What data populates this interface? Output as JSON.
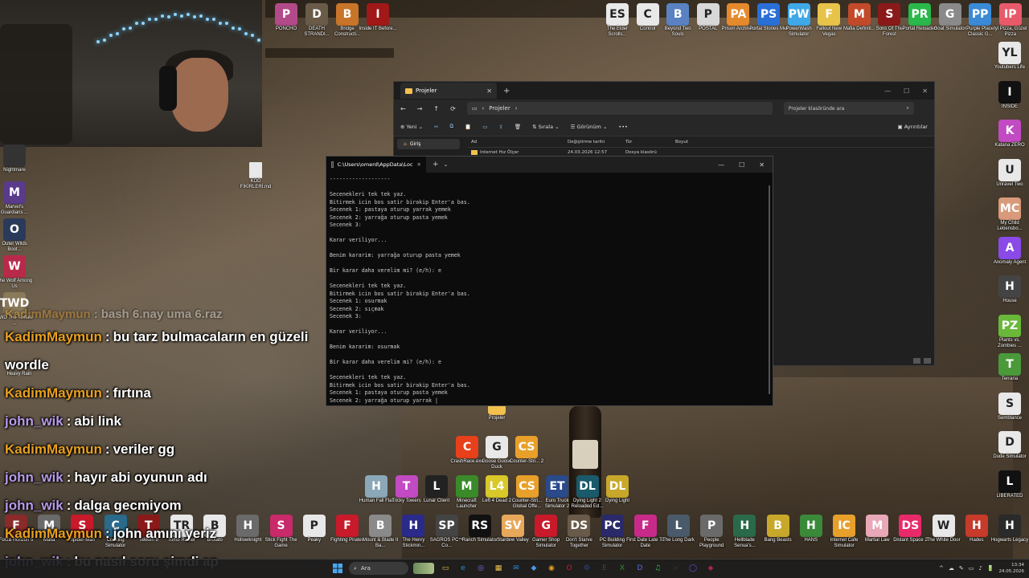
{
  "webcam": {},
  "desktop_icons_top": [
    {
      "label": "PONCHO",
      "color": "#b24a8a",
      "glyph": "P"
    },
    {
      "label": "DEATH STRANDI...",
      "color": "#6a5b49",
      "glyph": "D"
    },
    {
      "label": "Bridge Constructi...",
      "color": "#c8752a",
      "glyph": "B"
    },
    {
      "label": "Inside IT Before...",
      "color": "#a01818",
      "glyph": "I"
    }
  ],
  "desktop_icons_right_top": [
    {
      "label": "The Elder Scrolls...",
      "color": "#e9e9e9",
      "glyph": "ES"
    },
    {
      "label": "Control",
      "color": "#e8e8e8",
      "glyph": "C"
    },
    {
      "label": "Beyond Two Souls",
      "color": "#5a82c2",
      "glyph": "B"
    },
    {
      "label": "POSTAL",
      "color": "#d8d8d8",
      "glyph": "P"
    },
    {
      "label": "Prison Architect",
      "color": "#e58a2c",
      "glyph": "PA"
    },
    {
      "label": "Portal Stories Mel",
      "color": "#2a6fd6",
      "glyph": "PS"
    },
    {
      "label": "PowerWash Simulator",
      "color": "#3fa8e8",
      "glyph": "PW"
    },
    {
      "label": "Fallout New Vegas",
      "color": "#e8c34a",
      "glyph": "F"
    },
    {
      "label": "Mafia Definiti...",
      "color": "#c24a2a",
      "glyph": "M"
    },
    {
      "label": "Sons Of The Forest",
      "color": "#8a1a1a",
      "glyph": "S"
    },
    {
      "label": "Portal Reloaded",
      "color": "#2ab84a",
      "glyph": "PR"
    },
    {
      "label": "Goat Simulator",
      "color": "#8a8a8a",
      "glyph": "G"
    },
    {
      "label": "Purple Place Classic G...",
      "color": "#3a8ad6",
      "glyph": "PP"
    },
    {
      "label": "Iyi Pizza, Güzel Pizza",
      "color": "#e85a6a",
      "glyph": "IP"
    }
  ],
  "desktop_icons_right_col": [
    {
      "label": "Youtubers Life",
      "color": "#e8e8e8",
      "glyph": "YL"
    },
    {
      "label": "INSIDE",
      "color": "#111111",
      "glyph": "I"
    },
    {
      "label": "Katana ZERO",
      "color": "#c24ac2",
      "glyph": "K"
    },
    {
      "label": "Unravel Two",
      "color": "#e8e8e8",
      "glyph": "U"
    },
    {
      "label": "My Child Lebensbo...",
      "color": "#d89a7a",
      "glyph": "MC"
    },
    {
      "label": "Anomaly Agent",
      "color": "#8a4ae8",
      "glyph": "A"
    },
    {
      "label": "House",
      "color": "#444444",
      "glyph": "H"
    },
    {
      "label": "Plants vs. Zombies ...",
      "color": "#6ab83a",
      "glyph": "PZ"
    },
    {
      "label": "Terraria",
      "color": "#4a9a3a",
      "glyph": "T"
    },
    {
      "label": "Semblance",
      "color": "#e8e8e8",
      "glyph": "S"
    },
    {
      "label": "Dude Simulator",
      "color": "#e8e8e8",
      "glyph": "D"
    },
    {
      "label": "LIBERATED",
      "color": "#111111",
      "glyph": "L"
    }
  ],
  "desktop_icons_left_col": [
    {
      "label": "Nightmare",
      "color": "#333333",
      "glyph": ""
    },
    {
      "label": "Marvel's Guardians ...",
      "color": "#5a3a8a",
      "glyph": "M"
    },
    {
      "label": "Outer Wilds Boot...",
      "color": "#2a3a5a",
      "glyph": "O"
    },
    {
      "label": "The Wolf Among Us",
      "color": "#b82a4a",
      "glyph": "W"
    },
    {
      "label": "TWD The Telltale ...",
      "color": "#8a7a5a",
      "glyph": "TWD"
    }
  ],
  "desktop_misc": {
    "kod_file": "KOD FİKİRLERİ.md",
    "projeler_folder": "Projeler",
    "heavy_rain": "Heavy Rain"
  },
  "desktop_icons_middle": [
    {
      "label": "CrashRace.exe",
      "color": "#e8401a",
      "glyph": "C"
    },
    {
      "label": "Goose Goose Duck",
      "color": "#e8e8e8",
      "glyph": "G"
    },
    {
      "label": "Counter-Stri... 2",
      "color": "#e8a02a",
      "glyph": "CS"
    }
  ],
  "desktop_icons_row2": [
    {
      "label": "Human Fall Flat",
      "color": "#8aa8b8",
      "glyph": "H"
    },
    {
      "label": "Tricky Towers",
      "color": "#c24ac2",
      "glyph": "T"
    },
    {
      "label": "Lunar Client",
      "color": "#222222",
      "glyph": "L"
    },
    {
      "label": "Minecraft Launcher",
      "color": "#3a8a2a",
      "glyph": "M"
    },
    {
      "label": "Left 4 Dead 2",
      "color": "#d8c82a",
      "glyph": "L4"
    },
    {
      "label": "Counter-Stri... Global Offe...",
      "color": "#e8a02a",
      "glyph": "CS"
    },
    {
      "label": "Euro Truck Simulator 2",
      "color": "#2a4a8a",
      "glyph": "ET"
    },
    {
      "label": "Dying Light 2 Reloaded Ed...",
      "color": "#1a5a6a",
      "glyph": "DL"
    },
    {
      "label": "Dying Light",
      "color": "#c8a82a",
      "glyph": "DL"
    }
  ],
  "desktop_icons_bottom": [
    {
      "label": "Forza Horizon 5",
      "color": "#8a2a2a",
      "glyph": "F"
    },
    {
      "label": "Mafia",
      "color": "#6a6a6a",
      "glyph": "M"
    },
    {
      "label": "Spider-Man",
      "color": "#c81a2a",
      "glyph": "S"
    },
    {
      "label": "Cooking Simulator",
      "color": "#2a6a8a",
      "glyph": "C"
    },
    {
      "label": "Tekken 8",
      "color": "#8a1a1a",
      "glyph": "T"
    },
    {
      "label": "Tomb Raider",
      "color": "#e8e8e8",
      "glyph": "TR"
    },
    {
      "label": "Brotato",
      "color": "#e8e8e8",
      "glyph": "B"
    },
    {
      "label": "Hollowknight",
      "color": "#6a6a6a",
      "glyph": "H"
    },
    {
      "label": "Stick Fight The Game",
      "color": "#c82a6a",
      "glyph": "S"
    },
    {
      "label": "Peaky",
      "color": "#e8e8e8",
      "glyph": "P"
    },
    {
      "label": "Fighting Pirates",
      "color": "#c81a2a",
      "glyph": "F"
    },
    {
      "label": "Mount & Blade II Ba...",
      "color": "#8a8a8a",
      "glyph": "B"
    },
    {
      "label": "The Henry Stickmin...",
      "color": "#2a2a8a",
      "glyph": "H"
    },
    {
      "label": "SAGROS PC™ Co...",
      "color": "#444444",
      "glyph": "SP"
    },
    {
      "label": "Ranch Simulator",
      "color": "#111111",
      "glyph": "RS"
    },
    {
      "label": "Stardew Valley",
      "color": "#e8a85a",
      "glyph": "SV"
    },
    {
      "label": "Gamer Shop Simulator",
      "color": "#c81a2a",
      "glyph": "G"
    },
    {
      "label": "Don't Starve Together",
      "color": "#6a5a4a",
      "glyph": "DS"
    },
    {
      "label": "PC Building Simulator",
      "color": "#2a2a6a",
      "glyph": "PC"
    },
    {
      "label": "First Date Late To Date",
      "color": "#c82a8a",
      "glyph": "F"
    },
    {
      "label": "The Long Dark",
      "color": "#4a5a6a",
      "glyph": "L"
    },
    {
      "label": "People Playground",
      "color": "#6a6a6a",
      "glyph": "P"
    },
    {
      "label": "Hellblade Senua's...",
      "color": "#2a6a4a",
      "glyph": "H"
    },
    {
      "label": "Bang Beasts",
      "color": "#c8a82a",
      "glyph": "B"
    },
    {
      "label": "HANS",
      "color": "#3a8a3a",
      "glyph": "H"
    },
    {
      "label": "Internet Cafe Simulator",
      "color": "#e8a02a",
      "glyph": "IC"
    },
    {
      "label": "Martial Law",
      "color": "#e8a8b8",
      "glyph": "M"
    },
    {
      "label": "Distant Space 2",
      "color": "#e82a6a",
      "glyph": "DS"
    },
    {
      "label": "The White Door",
      "color": "#e8e8e8",
      "glyph": "W"
    },
    {
      "label": "Hades",
      "color": "#c83a2a",
      "glyph": "H"
    },
    {
      "label": "Hogwarts Legacy",
      "color": "#2a2a2a",
      "glyph": "H"
    }
  ],
  "explorer": {
    "tab_title": "Projeler",
    "close": "✕",
    "new_tab": "+",
    "window_controls": [
      "—",
      "☐",
      "✕"
    ],
    "nav": [
      "←",
      "→",
      "↑",
      "⟳",
      "▭"
    ],
    "breadcrumb": "Projeler",
    "search_placeholder": "Projeler klasöründe ara",
    "cmd": {
      "new": "Yeni",
      "sort": "Sırala",
      "view": "Görünüm",
      "more": "•••",
      "details": "Ayrıntılar"
    },
    "navpane_home": "Giriş",
    "columns": {
      "name": "Ad",
      "date": "Değiştirme tarihi",
      "type": "Tür",
      "size": "Boyut"
    },
    "rows": [
      {
        "name": "Internet Hız Ölçer",
        "date": "24.03.2026 12:57",
        "type": "Dosya klasörü",
        "size": ""
      }
    ]
  },
  "terminal": {
    "tab_title": "C:\\Users\\omerd\\AppData\\Loc",
    "plus": "+",
    "dropdown": "⌄",
    "controls": [
      "—",
      "☐",
      "✕"
    ],
    "lines": [
      "-------------------",
      "",
      "Secenekleri tek tek yaz.",
      "Bitirmek icin bos satir birakip Enter'a bas.",
      "Secenek 1: pastaya oturup yarrak yemek",
      "Secenek 2: yarrağa oturup pasta yemek",
      "Secenek 3:",
      "",
      "Karar veriliyor...",
      "",
      "Benim kararim: yarrağa oturup pasta yemek",
      "",
      "Bir karar daha verelim mi? (e/h): e",
      "",
      "Secenekleri tek tek yaz.",
      "Bitirmek icin bos satir birakip Enter'a bas.",
      "Secenek 1: osurmak",
      "Secenek 2: sıçmak",
      "Secenek 3:",
      "",
      "Karar veriliyor...",
      "",
      "Benim kararim: osurmak",
      "",
      "Bir karar daha verelim mi? (e/h): e",
      "",
      "Secenekleri tek tek yaz.",
      "Bitirmek icin bos satir birakip Enter'a bas.",
      "Secenek 1: pastaya oturup pasta yemek",
      "Secenek 2: yarrağa oturup yarrak |"
    ]
  },
  "chat": [
    {
      "user": "KadimMaymun",
      "color": "#e8a020",
      "msg": "bash 6.nay uma 6.raz",
      "faded": true
    },
    {
      "user": "KadimMaymun",
      "color": "#e8a020",
      "msg": "bu tarz bulmacaların en güzeli"
    },
    {
      "user": "",
      "color": "#ffffff",
      "msg": "wordle"
    },
    {
      "user": "KadimMaymun",
      "color": "#e8a020",
      "msg": "fırtına"
    },
    {
      "user": "john_wik",
      "color": "#b89ae8",
      "msg": "abi link"
    },
    {
      "user": "KadimMaymun",
      "color": "#e8a020",
      "msg": "veriler gg"
    },
    {
      "user": "john_wik",
      "color": "#b89ae8",
      "msg": "hayır abi oyunun adı"
    },
    {
      "user": "john_wik",
      "color": "#b89ae8",
      "msg": "dalga gecmiyom"
    },
    {
      "user": "KadimMaymun",
      "color": "#e8a020",
      "msg": "john amını yeriz"
    },
    {
      "user": "john_wik",
      "color": "#b89ae8",
      "msg": "bu nasıl soru şimdi ap"
    }
  ],
  "taskbar": {
    "search_label": "Ara",
    "apps": [
      {
        "name": "file-explorer",
        "glyph": "▭",
        "color": "#f2c14e"
      },
      {
        "name": "edge",
        "glyph": "e",
        "color": "#2a8ad6"
      },
      {
        "name": "copilot",
        "glyph": "◎",
        "color": "#8a6ae8"
      },
      {
        "name": "files",
        "glyph": "▦",
        "color": "#f2c14e"
      },
      {
        "name": "mail",
        "glyph": "✉",
        "color": "#2a8ad6"
      },
      {
        "name": "store",
        "glyph": "◆",
        "color": "#4a9ae8"
      },
      {
        "name": "chrome",
        "glyph": "◉",
        "color": "#e8a02a"
      },
      {
        "name": "opera",
        "glyph": "O",
        "color": "#c81a2a"
      },
      {
        "name": "steam",
        "glyph": "⚙",
        "color": "#2a4a8a"
      },
      {
        "name": "epic",
        "glyph": "E",
        "color": "#444444"
      },
      {
        "name": "xbox",
        "glyph": "X",
        "color": "#3a8a3a"
      },
      {
        "name": "discord",
        "glyph": "D",
        "color": "#5a6ae8"
      },
      {
        "name": "spotify",
        "glyph": "♫",
        "color": "#2ab84a"
      },
      {
        "name": "terminal",
        "glyph": ">",
        "color": "#333333"
      },
      {
        "name": "obs",
        "glyph": "◯",
        "color": "#6a4ae8"
      },
      {
        "name": "editor",
        "glyph": "◈",
        "color": "#c82a6a"
      }
    ],
    "tray": [
      "^",
      "☁",
      "✎",
      "▭",
      "♪",
      "🔋"
    ],
    "time": "13:34",
    "date": "24.05.2026"
  }
}
